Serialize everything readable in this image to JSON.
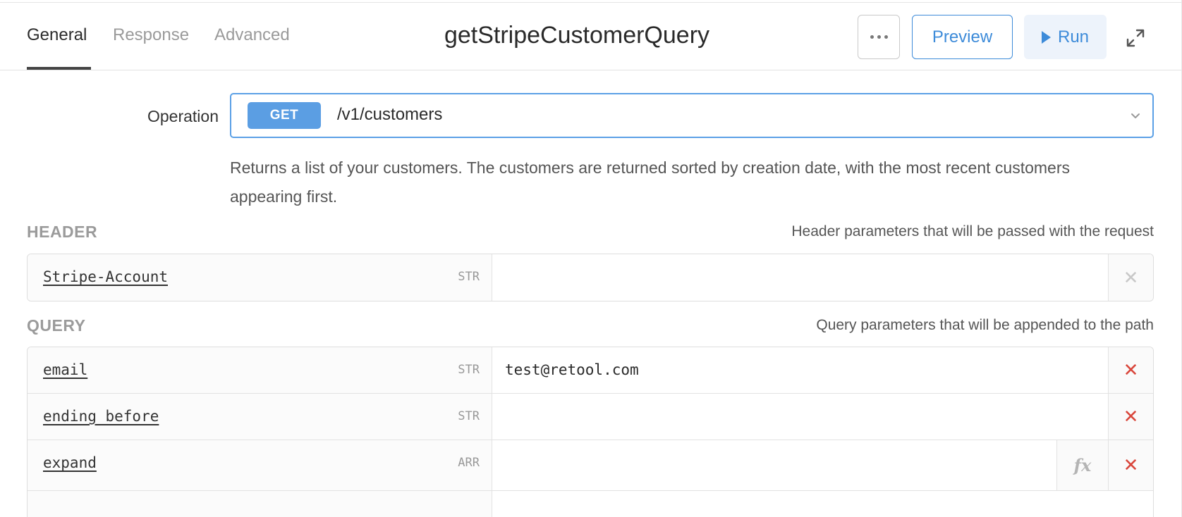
{
  "tabs": [
    {
      "label": "General",
      "active": true
    },
    {
      "label": "Response",
      "active": false
    },
    {
      "label": "Advanced",
      "active": false
    }
  ],
  "query_name": "getStripeCustomerQuery",
  "toolbar": {
    "more_icon": "more-horizontal-icon",
    "preview_label": "Preview",
    "run_label": "Run",
    "run_icon": "play-icon",
    "expand_icon": "expand-icon",
    "accent_color": "#3d8bd9"
  },
  "operation": {
    "label": "Operation",
    "method": "GET",
    "path": "/v1/customers",
    "dropdown_icon": "chevron-down-icon",
    "description": "Returns a list of your customers. The customers are returned sorted by creation date, with the most recent customers appearing first."
  },
  "header_section": {
    "title": "HEADER",
    "hint": "Header parameters that will be passed with the request",
    "params": [
      {
        "name": "Stripe-Account",
        "type": "STR",
        "value": "",
        "removable": false
      }
    ]
  },
  "query_section": {
    "title": "QUERY",
    "hint": "Query parameters that will be appended to the path",
    "params": [
      {
        "name": "email",
        "type": "STR",
        "value": "test@retool.com",
        "removable": true
      },
      {
        "name": "ending_before",
        "type": "STR",
        "value": "",
        "removable": true
      },
      {
        "name": "expand",
        "type": "ARR",
        "value": "",
        "removable": true,
        "fx": "fx"
      }
    ]
  },
  "remove_icon": "close-icon"
}
